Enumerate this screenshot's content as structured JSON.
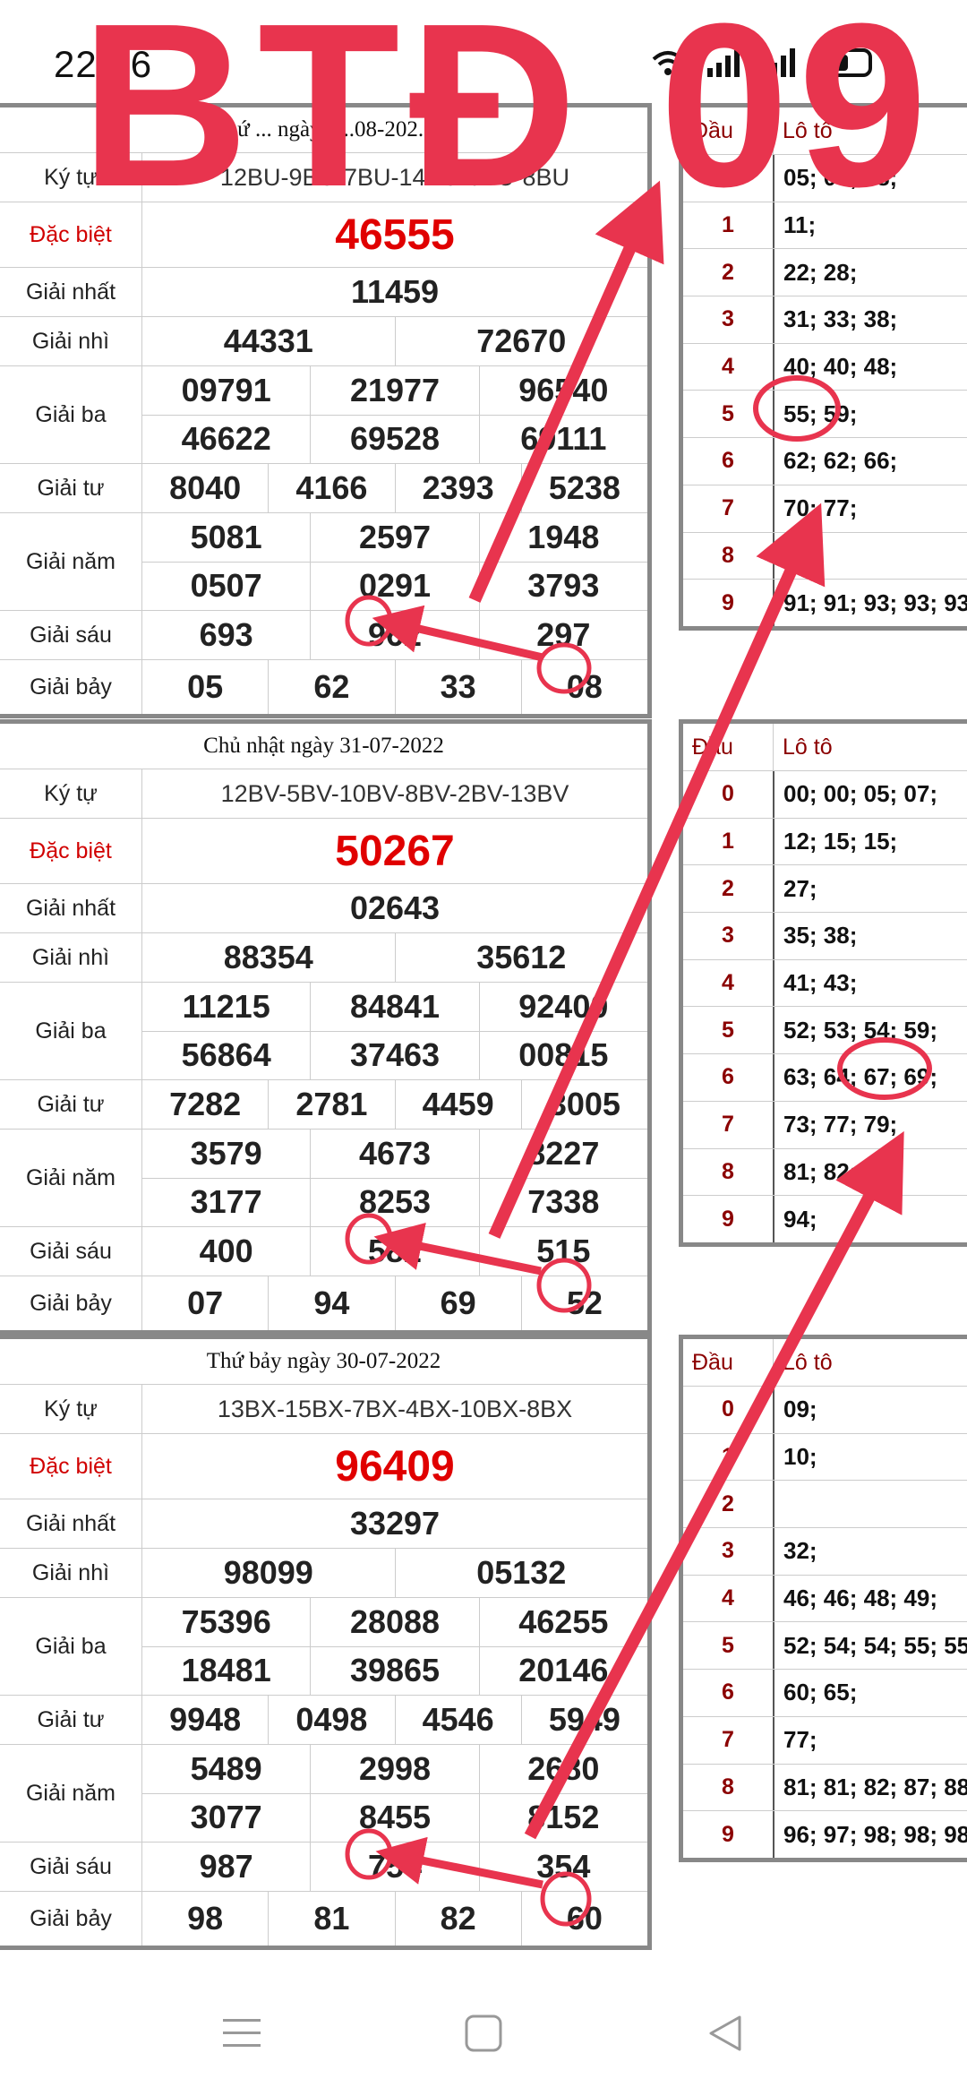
{
  "status": {
    "time": "22:46"
  },
  "watermark": "BTĐ 09",
  "results": [
    {
      "header": "Thứ ... ngày 0...08-202...",
      "rows": [
        {
          "label": "Ký tự",
          "values": [
            [
              "12BU-9BU-7BU-14BU-6BU-8BU"
            ]
          ]
        },
        {
          "label": "Đặc biệt",
          "values": [
            [
              "46555"
            ]
          ]
        },
        {
          "label": "Giải nhất",
          "values": [
            [
              "11459"
            ]
          ]
        },
        {
          "label": "Giải nhì",
          "values": [
            [
              "44331",
              "72670"
            ]
          ]
        },
        {
          "label": "Giải ba",
          "values": [
            [
              "09791",
              "21977",
              "96540"
            ],
            [
              "46622",
              "69528",
              "69111"
            ]
          ]
        },
        {
          "label": "Giải tư",
          "values": [
            [
              "8040",
              "4166",
              "2393",
              "5238"
            ]
          ]
        },
        {
          "label": "Giải năm",
          "values": [
            [
              "5081",
              "2597",
              "1948"
            ],
            [
              "0507",
              "0291",
              "3793"
            ]
          ]
        },
        {
          "label": "Giải sáu",
          "values": [
            [
              "693",
              "962",
              "297"
            ]
          ]
        },
        {
          "label": "Giải bảy",
          "values": [
            [
              "05",
              "62",
              "33",
              "08"
            ]
          ]
        }
      ]
    },
    {
      "header": "Chủ nhật ngày 31-07-2022",
      "rows": [
        {
          "label": "Ký tự",
          "values": [
            [
              "12BV-5BV-10BV-8BV-2BV-13BV"
            ]
          ]
        },
        {
          "label": "Đặc biệt",
          "values": [
            [
              "50267"
            ]
          ]
        },
        {
          "label": "Giải nhất",
          "values": [
            [
              "02643"
            ]
          ]
        },
        {
          "label": "Giải nhì",
          "values": [
            [
              "88354",
              "35612"
            ]
          ]
        },
        {
          "label": "Giải ba",
          "values": [
            [
              "11215",
              "84841",
              "92400"
            ],
            [
              "56864",
              "37463",
              "00815"
            ]
          ]
        },
        {
          "label": "Giải tư",
          "values": [
            [
              "7282",
              "2781",
              "4459",
              "3005"
            ]
          ]
        },
        {
          "label": "Giải năm",
          "values": [
            [
              "3579",
              "4673",
              "8227"
            ],
            [
              "3177",
              "8253",
              "7338"
            ]
          ]
        },
        {
          "label": "Giải sáu",
          "values": [
            [
              "400",
              "582",
              "515"
            ]
          ]
        },
        {
          "label": "Giải bảy",
          "values": [
            [
              "07",
              "94",
              "69",
              "52"
            ]
          ]
        }
      ]
    },
    {
      "header": "Thứ bảy ngày 30-07-2022",
      "rows": [
        {
          "label": "Ký tự",
          "values": [
            [
              "13BX-15BX-7BX-4BX-10BX-8BX"
            ]
          ]
        },
        {
          "label": "Đặc biệt",
          "values": [
            [
              "96409"
            ]
          ]
        },
        {
          "label": "Giải nhất",
          "values": [
            [
              "33297"
            ]
          ]
        },
        {
          "label": "Giải nhì",
          "values": [
            [
              "98099",
              "05132"
            ]
          ]
        },
        {
          "label": "Giải ba",
          "values": [
            [
              "75396",
              "28088",
              "46255"
            ],
            [
              "18481",
              "39865",
              "20146"
            ]
          ]
        },
        {
          "label": "Giải tư",
          "values": [
            [
              "9948",
              "0498",
              "4546",
              "5949"
            ]
          ]
        },
        {
          "label": "Giải năm",
          "values": [
            [
              "5489",
              "2998",
              "2680"
            ],
            [
              "3077",
              "8455",
              "8152"
            ]
          ]
        },
        {
          "label": "Giải sáu",
          "values": [
            [
              "987",
              "754",
              "354"
            ]
          ]
        },
        {
          "label": "Giải bảy",
          "values": [
            [
              "98",
              "81",
              "82",
              "60"
            ]
          ]
        }
      ]
    }
  ],
  "lotos": [
    {
      "head_label": "Đầu",
      "value_label": "Lô tô",
      "rows": [
        {
          "d": "0",
          "v": "05; 07; 08;"
        },
        {
          "d": "1",
          "v": "11;"
        },
        {
          "d": "2",
          "v": "22; 28;"
        },
        {
          "d": "3",
          "v": "31; 33; 38;"
        },
        {
          "d": "4",
          "v": "40; 40; 48;"
        },
        {
          "d": "5",
          "v": "55; 59;"
        },
        {
          "d": "6",
          "v": "62; 62; 66;"
        },
        {
          "d": "7",
          "v": "70; 77;"
        },
        {
          "d": "8",
          "v": ""
        },
        {
          "d": "9",
          "v": "91; 91; 93; 93; 93"
        }
      ]
    },
    {
      "head_label": "Đầu",
      "value_label": "Lô tô",
      "rows": [
        {
          "d": "0",
          "v": "00; 00; 05; 07;"
        },
        {
          "d": "1",
          "v": "12; 15; 15;"
        },
        {
          "d": "2",
          "v": "27;"
        },
        {
          "d": "3",
          "v": "35; 38;"
        },
        {
          "d": "4",
          "v": "41; 43;"
        },
        {
          "d": "5",
          "v": "52; 53; 54; 59;"
        },
        {
          "d": "6",
          "v": "63; 64; 67; 69;"
        },
        {
          "d": "7",
          "v": "73; 77; 79;"
        },
        {
          "d": "8",
          "v": "81; 82;"
        },
        {
          "d": "9",
          "v": "94;"
        }
      ]
    },
    {
      "head_label": "Đầu",
      "value_label": "Lô tô",
      "rows": [
        {
          "d": "0",
          "v": "09;"
        },
        {
          "d": "1",
          "v": "10;"
        },
        {
          "d": "2",
          "v": ""
        },
        {
          "d": "3",
          "v": "32;"
        },
        {
          "d": "4",
          "v": "46; 46; 48; 49;"
        },
        {
          "d": "5",
          "v": "52; 54; 54; 55; 55"
        },
        {
          "d": "6",
          "v": "60; 65;"
        },
        {
          "d": "7",
          "v": "77;"
        },
        {
          "d": "8",
          "v": "81; 81; 82; 87; 88"
        },
        {
          "d": "9",
          "v": "96; 97; 98; 98; 98"
        }
      ]
    }
  ],
  "colors": {
    "annotation": "#e8344e",
    "special": "#e00000",
    "head": "#8b0000"
  },
  "icons": [
    "wifi-icon",
    "signal-icon",
    "battery-icon",
    "charging-icon",
    "menu-nav-icon",
    "home-nav-icon",
    "back-nav-icon"
  ]
}
